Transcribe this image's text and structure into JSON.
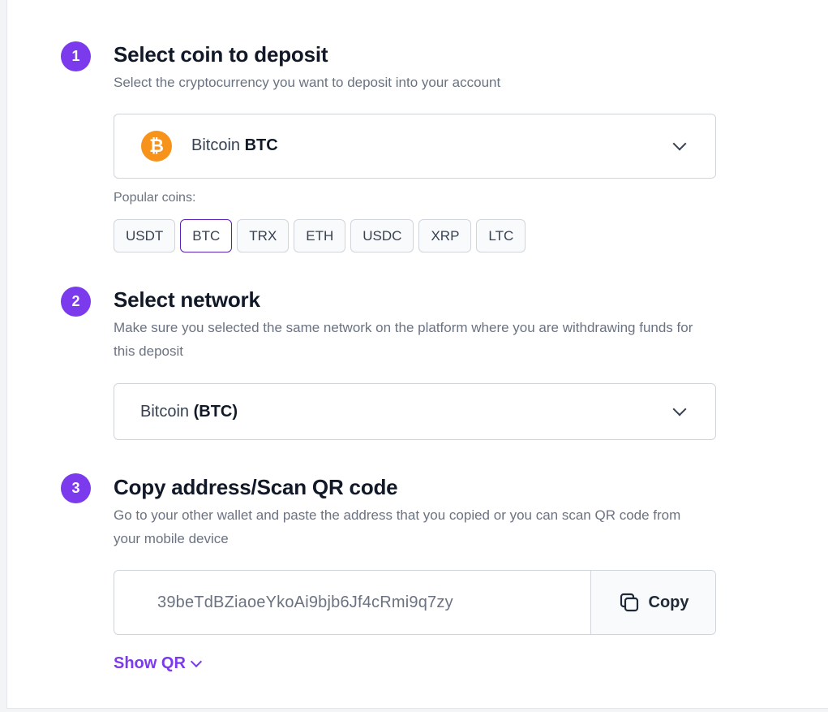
{
  "step1": {
    "number": "1",
    "title": "Select coin to deposit",
    "description": "Select the cryptocurrency you want to deposit into your account",
    "selected_coin": {
      "name": "Bitcoin",
      "symbol": "BTC",
      "icon": "bitcoin-icon",
      "icon_glyph": "₿"
    },
    "popular_label": "Popular coins:",
    "popular_coins": [
      "USDT",
      "BTC",
      "TRX",
      "ETH",
      "USDC",
      "XRP",
      "LTC"
    ],
    "active_coin": "BTC"
  },
  "step2": {
    "number": "2",
    "title": "Select network",
    "description": "Make sure you selected the same network on the platform where you are withdrawing funds for this deposit",
    "network_name": "Bitcoin",
    "network_symbol": "(BTC)"
  },
  "step3": {
    "number": "3",
    "title": "Copy address/Scan QR code",
    "description": "Go to your other wallet and paste the address that you copied or you can scan QR code from your mobile device",
    "address": "39beTdBZiaoeYkoAi9bjb6Jf4cRmi9q7zy",
    "copy_label": "Copy",
    "copy_icon": "copy-icon",
    "show_qr_label": "Show QR"
  },
  "colors": {
    "accent": "#7c3aed",
    "bitcoin": "#f7931a",
    "border": "#d1d5db",
    "muted_text": "#6b7280"
  }
}
